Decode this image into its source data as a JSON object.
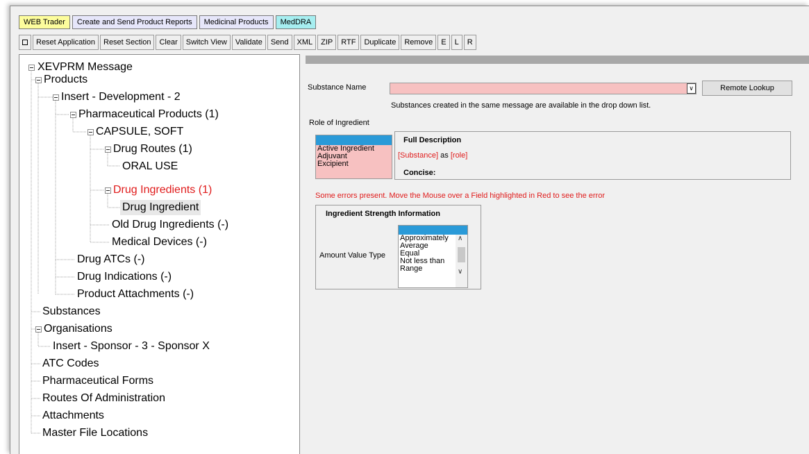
{
  "tabs": [
    {
      "label": "WEB Trader",
      "color": "#fdfd9c"
    },
    {
      "label": "Create and Send Product Reports",
      "color": "#e6e6fa"
    },
    {
      "label": "Medicinal Products",
      "color": "#e6e6fa"
    },
    {
      "label": "MedDRA",
      "color": "#a6eef0"
    }
  ],
  "toolbar": {
    "buttons": [
      "Reset Application",
      "Reset Section",
      "Clear",
      "Switch View",
      "Validate",
      "Send",
      "XML",
      "ZIP",
      "RTF",
      "Duplicate",
      "Remove",
      "E",
      "L",
      "R"
    ]
  },
  "tree": {
    "root": "XEVPRM Message",
    "products": "Products",
    "insert_dev": "Insert - Development - 2",
    "pharm_products": "Pharmaceutical Products (1)",
    "capsule": "CAPSULE, SOFT",
    "drug_routes": "Drug Routes (1)",
    "oral_use": "ORAL USE",
    "drug_ingredients": "Drug Ingredients (1)",
    "drug_ingredient": "Drug Ingredient",
    "old_drug_ingredients": "Old Drug Ingredients (-)",
    "medical_devices": "Medical Devices (-)",
    "drug_atcs": "Drug ATCs (-)",
    "drug_indications": "Drug Indications (-)",
    "product_attachments": "Product Attachments (-)",
    "substances": "Substances",
    "organisations": "Organisations",
    "insert_sponsor": "Insert - Sponsor - 3 - Sponsor X",
    "atc_codes": "ATC Codes",
    "pharm_forms": "Pharmaceutical Forms",
    "routes_admin": "Routes Of Administration",
    "attachments": "Attachments",
    "master_file_locations": "Master File Locations"
  },
  "form": {
    "substance_label": "Substance Name",
    "substance_value": "",
    "remote_lookup": "Remote Lookup",
    "substance_hint": "Substances created in the same message are available in the drop down list.",
    "role_label": "Role of Ingredient",
    "role_options": [
      "Active Ingredient",
      "Adjuvant",
      "Excipient"
    ],
    "full_description_title": "Full Description",
    "desc_substance": "[Substance]",
    "desc_as": "as",
    "desc_role": "[role]",
    "concise_label": "Concise:",
    "error_message": "Some errors present. Move the Mouse over a Field highlighted in Red to see the error",
    "strength_title": "Ingredient Strength Information",
    "amount_value_type_label": "Amount Value Type",
    "amount_options": [
      "Approximately",
      "Average",
      "Equal",
      "Not less than",
      "Range"
    ]
  },
  "colors": {
    "error_text": "#e01b1b",
    "invalid_field": "#f7c1c1",
    "selection": "#2a9ad8"
  }
}
